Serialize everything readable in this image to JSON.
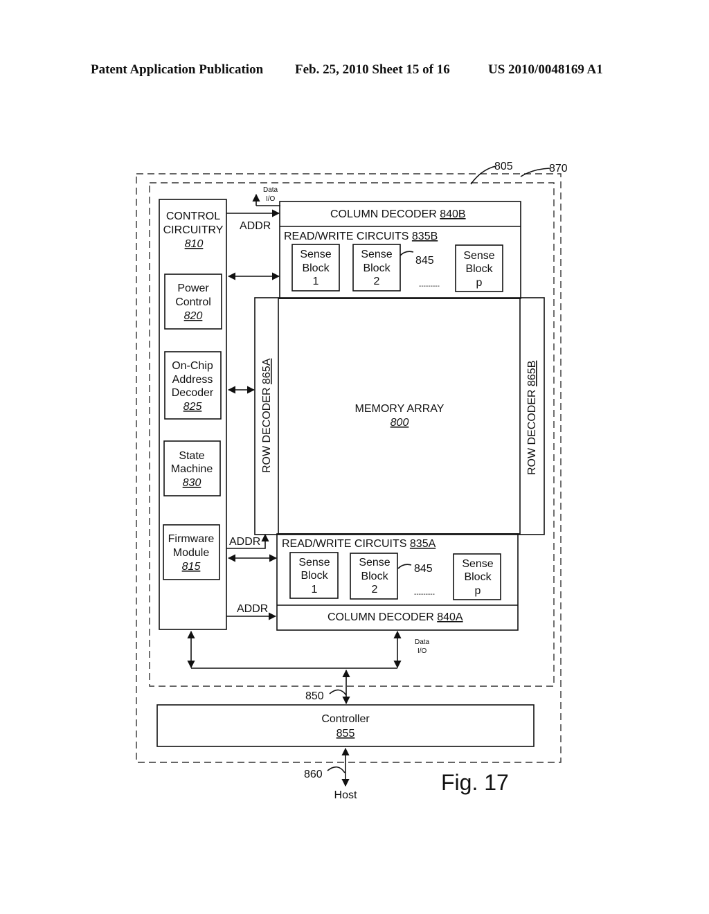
{
  "header": {
    "publication": "Patent Application Publication",
    "date_sheet": "Feb. 25, 2010  Sheet 15 of 16",
    "patent_number": "US 2010/0048169 A1"
  },
  "figure": {
    "label": "Fig. 17",
    "refs": {
      "outer_boundary": "870",
      "chip_boundary": "805",
      "bus_850": "850",
      "bus_860": "860",
      "sense_ref": "845"
    },
    "control": {
      "title_1": "CONTROL",
      "title_2": "CIRCUITRY",
      "num": "810",
      "power": {
        "l1": "Power",
        "l2": "Control",
        "num": "820"
      },
      "decoder": {
        "l1": "On-Chip",
        "l2": "Address",
        "l3": "Decoder",
        "num": "825"
      },
      "state": {
        "l1": "State",
        "l2": "Machine",
        "num": "830"
      },
      "firmware": {
        "l1": "Firmware",
        "l2": "Module",
        "num": "815"
      }
    },
    "addr": "ADDR",
    "data_io": {
      "l1": "Data",
      "l2": "I/O"
    },
    "col_decoder_b": {
      "text": "COLUMN DECODER ",
      "num": "840B"
    },
    "col_decoder_a": {
      "text": "COLUMN DECODER ",
      "num": "840A"
    },
    "rw_b": {
      "text": "READ/WRITE CIRCUITS ",
      "num": "835B"
    },
    "rw_a": {
      "text": "READ/WRITE CIRCUITS ",
      "num": "835A"
    },
    "sense": {
      "l1": "Sense",
      "l2": "Block",
      "ids": [
        "1",
        "2",
        "p"
      ]
    },
    "ellipsis": "---------",
    "memory": {
      "text": "MEMORY ARRAY",
      "num": "800"
    },
    "row_a": {
      "text": "ROW DECODER ",
      "num": "865A"
    },
    "row_b": {
      "text": "ROW DECODER ",
      "num": "865B"
    },
    "controller": {
      "text": "Controller",
      "num": "855"
    },
    "host": "Host"
  }
}
